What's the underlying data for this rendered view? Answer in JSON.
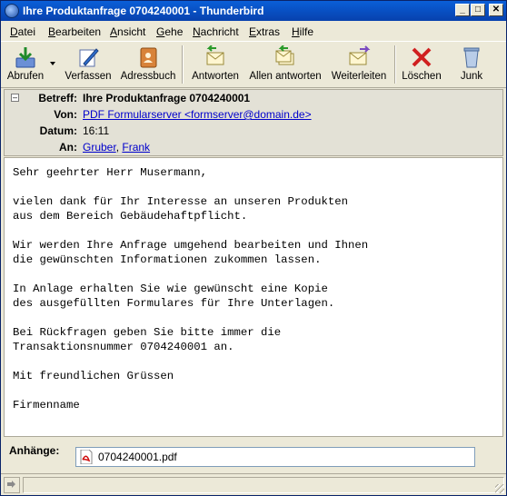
{
  "window": {
    "title": "Ihre Produktanfrage 0704240001 - Thunderbird",
    "minimize": "_",
    "maximize": "□",
    "close": "✕"
  },
  "menu": [
    {
      "label": "Datei",
      "u": "D",
      "rest": "atei"
    },
    {
      "label": "Bearbeiten",
      "u": "B",
      "rest": "earbeiten"
    },
    {
      "label": "Ansicht",
      "u": "A",
      "rest": "nsicht"
    },
    {
      "label": "Gehe",
      "u": "G",
      "rest": "ehe"
    },
    {
      "label": "Nachricht",
      "u": "N",
      "rest": "achricht"
    },
    {
      "label": "Extras",
      "u": "E",
      "rest": "xtras"
    },
    {
      "label": "Hilfe",
      "u": "H",
      "rest": "ilfe"
    }
  ],
  "toolbar": {
    "abrufen": "Abrufen",
    "verfassen": "Verfassen",
    "adressbuch": "Adressbuch",
    "antworten": "Antworten",
    "allen_antworten": "Allen antworten",
    "weiterleiten": "Weiterleiten",
    "loeschen": "Löschen",
    "junk": "Junk"
  },
  "header": {
    "betreff_label": "Betreff:",
    "betreff_value": "Ihre Produktanfrage 0704240001",
    "von_label": "Von:",
    "von_value": "PDF Formularserver <formserver@domain.de>",
    "datum_label": "Datum:",
    "datum_value": "16:11",
    "an_label": "An:",
    "an_first": "Gruber",
    "an_sep": ",",
    "an_second": "Frank"
  },
  "body": {
    "text": "Sehr geehrter Herr Musermann,\n\nvielen dank für Ihr Interesse an unseren Produkten\naus dem Bereich Gebäudehaftpflicht.\n\nWir werden Ihre Anfrage umgehend bearbeiten und Ihnen\ndie gewünschten Informationen zukommen lassen.\n\nIn Anlage erhalten Sie wie gewünscht eine Kopie\ndes ausgefüllten Formulares für Ihre Unterlagen.\n\nBei Rückfragen geben Sie bitte immer die\nTransaktionsnummer 0704240001 an.\n\nMit freundlichen Grüssen\n\nFirmenname"
  },
  "attachments": {
    "label": "Anhänge:",
    "file": "0704240001.pdf"
  },
  "colors": {
    "titlebar": "#0A5FD8",
    "chrome": "#ECE9D8",
    "link": "#0000CC"
  },
  "icons": [
    "app-icon",
    "abrufen-icon",
    "verfassen-icon",
    "adressbuch-icon",
    "antworten-icon",
    "allen-antworten-icon",
    "weiterleiten-icon",
    "loeschen-icon",
    "junk-icon",
    "pdf-icon",
    "online-status-icon"
  ]
}
